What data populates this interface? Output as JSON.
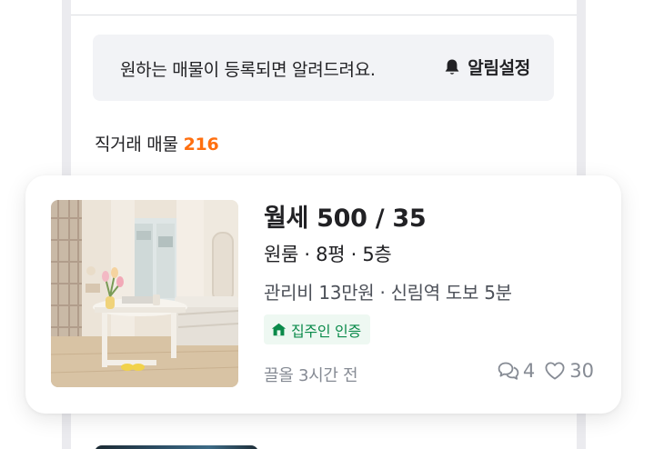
{
  "alert": {
    "message": "원하는 매물이 등록되면 알려드려요.",
    "setting_label": "알림설정",
    "icon": "bell-icon"
  },
  "section": {
    "title": "직거래 매물",
    "count": "216"
  },
  "listing": {
    "price": "월세 500 / 35",
    "specs": "원룸 · 8평 · 5층",
    "extra": "관리비 13만원 · 신림역 도보 5분",
    "badge": "집주인 인증",
    "badge_icon": "house-icon",
    "time": "끌올 3시간 전",
    "chat_count": "4",
    "like_count": "30",
    "chat_icon": "chat-bubbles-icon",
    "like_icon": "heart-icon",
    "thumbnail": "room-photo"
  },
  "colors": {
    "accent": "#ff6f0f",
    "verify_green": "#0a8a4a",
    "verify_bg": "#eef8f2",
    "banner_bg": "#f2f3f6",
    "muted": "#868b94"
  }
}
